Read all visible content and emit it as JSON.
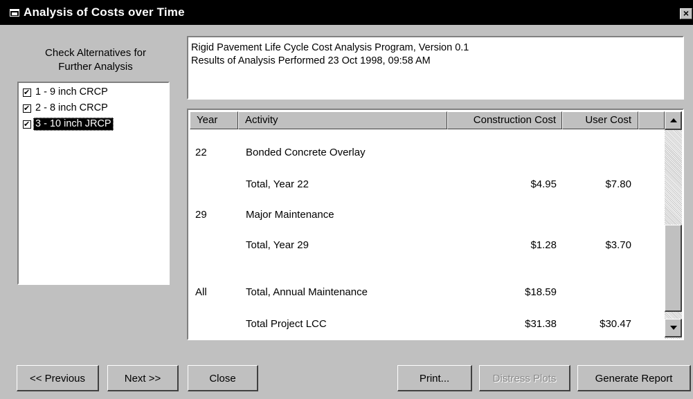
{
  "window": {
    "title": "Analysis of Costs over Time",
    "close_label": "×"
  },
  "alternatives": {
    "heading_line1": "Check Alternatives for",
    "heading_line2": "Further Analysis",
    "items": [
      {
        "label": "1 - 9 inch CRCP",
        "checked": true,
        "selected": false
      },
      {
        "label": "2 - 8 inch CRCP",
        "checked": true,
        "selected": false
      },
      {
        "label": "3 - 10 inch JRCP",
        "checked": true,
        "selected": true
      }
    ]
  },
  "info": {
    "line1": "Rigid Pavement Life Cycle Cost Analysis Program, Version 0.1",
    "line2": "Results of Analysis Performed 23 Oct 1998, 09:58 AM"
  },
  "results": {
    "columns": [
      "Year",
      "Activity",
      "Construction Cost",
      "User Cost"
    ],
    "rows": [
      {
        "year": "22",
        "activity": "Bonded Concrete Overlay",
        "construction": "",
        "user": ""
      },
      {
        "year": "",
        "activity": "Total, Year 22",
        "construction": "$4.95",
        "user": "$7.80"
      },
      {
        "year": "29",
        "activity": "Major Maintenance",
        "construction": "",
        "user": ""
      },
      {
        "year": "",
        "activity": "Total, Year 29",
        "construction": "$1.28",
        "user": "$3.70"
      },
      {
        "year": "All",
        "activity": "Total, Annual Maintenance",
        "construction": "$18.59",
        "user": ""
      },
      {
        "year": "",
        "activity": "Total Project LCC",
        "construction": "$31.38",
        "user": "$30.47"
      }
    ]
  },
  "buttons": {
    "previous": "<< Previous",
    "next": "Next >>",
    "close": "Close",
    "print": "Print...",
    "distress_plots": "Distress Plots",
    "generate_report": "Generate Report"
  },
  "icons": {
    "window_icon": "window-icon",
    "close": "close-icon",
    "scroll_up": "scroll-up-arrow-icon",
    "scroll_down": "scroll-down-arrow-icon"
  }
}
